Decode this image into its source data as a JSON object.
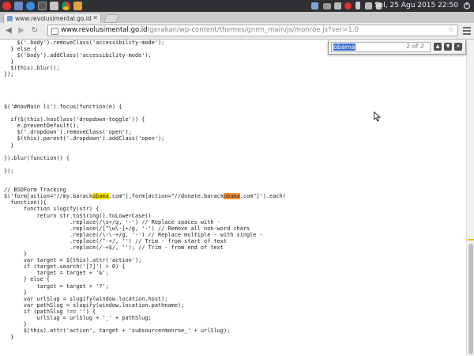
{
  "system_panel": {
    "clock": "Sel, 25 Agu 2015 22:50",
    "icons": [
      "app-menu-icon",
      "files-icon",
      "browser-icon",
      "terminal-icon",
      "editor-icon",
      "chrome-icon",
      "image-icon"
    ],
    "tray_icons": [
      "update-icon",
      "mail-icon",
      "network-icon",
      "record-icon",
      "bluetooth-icon",
      "battery-icon",
      "volume-icon"
    ]
  },
  "browser": {
    "tab_title": "www.revolusimental.go.id",
    "url_host": "www.revolusimental.go.id",
    "url_path": "/gerakan/wp-content/themes/gnrm_main/js/monroe.js?ver=1.0"
  },
  "find_bar": {
    "query": "obama",
    "count": "2 of 2"
  },
  "code": {
    "lines": [
      [
        {
          "t": "    $('.body').removeClass('accessibility-mode');"
        }
      ],
      [
        {
          "t": "  } else {"
        }
      ],
      [
        {
          "t": "    $('body').addClass('accessibility-mode');"
        }
      ],
      [
        {
          "t": "  }"
        }
      ],
      [
        {
          "t": "  $(this).blur();"
        }
      ],
      [
        {
          "t": "});"
        }
      ],
      [
        {
          "t": ""
        }
      ],
      [
        {
          "t": ""
        }
      ],
      [
        {
          "t": ""
        }
      ],
      [
        {
          "t": ""
        }
      ],
      [
        {
          "t": "$('#navMain li').focus(function(e) {"
        }
      ],
      [
        {
          "t": ""
        }
      ],
      [
        {
          "t": "  if($(this).hasClass('dropdown-toggle')) {"
        }
      ],
      [
        {
          "t": "    e.preventDefault();"
        }
      ],
      [
        {
          "t": "    $('.dropdown').removeClass('open');"
        }
      ],
      [
        {
          "t": "    $(this).parent('.dropdown').addClass('open');"
        }
      ],
      [
        {
          "t": "  }"
        }
      ],
      [
        {
          "t": ""
        }
      ],
      [
        {
          "t": "}).blur(function() {"
        }
      ],
      [
        {
          "t": ""
        }
      ],
      [
        {
          "t": "});"
        }
      ],
      [
        {
          "t": ""
        }
      ],
      [
        {
          "t": ""
        }
      ],
      [
        {
          "t": "// BSDForm Tracking"
        }
      ],
      [
        {
          "t": "$('form[action=\"//my.barack"
        },
        {
          "t": "obama",
          "h": "hl"
        },
        {
          "t": ".com\"],form[action=\"//donate.barack"
        },
        {
          "t": "obama",
          "h": "hl-active"
        },
        {
          "t": ".com\"]').each("
        }
      ],
      [
        {
          "t": "  function(){"
        }
      ],
      [
        {
          "t": "      function slugify(str) {"
        }
      ],
      [
        {
          "t": "          return str.toString().toLowerCase()"
        }
      ],
      [
        {
          "t": "                    .replace(/\\s+/g, '-') // Replace spaces with -"
        }
      ],
      [
        {
          "t": "                    .replace(/[^\\w\\-]+/g, '-') // Remove all non-word chars"
        }
      ],
      [
        {
          "t": "                    .replace(/\\-\\-+/g, '-') // Replace multiple - with single -"
        }
      ],
      [
        {
          "t": "                    .replace(/^-+/, '') // Trim - from start of text"
        }
      ],
      [
        {
          "t": "                    .replace(/-+$/, ''); // Trim - from end of text"
        }
      ],
      [
        {
          "t": "      }"
        }
      ],
      [
        {
          "t": "      var target = $(this).attr('action');"
        }
      ],
      [
        {
          "t": "      if (target.search('[?]') > 0) {"
        }
      ],
      [
        {
          "t": "          target = target + '&';"
        }
      ],
      [
        {
          "t": "      } else {"
        }
      ],
      [
        {
          "t": "          target = target + '?';"
        }
      ],
      [
        {
          "t": "      }"
        }
      ],
      [
        {
          "t": "      var urlSlug = slugify(window.location.host);"
        }
      ],
      [
        {
          "t": "      var pathSlug = slugify(window.location.pathname);"
        }
      ],
      [
        {
          "t": "      if (pathSlug !== '') {"
        }
      ],
      [
        {
          "t": "          urlSlug = urlSlug + '_' + pathSlug;"
        }
      ],
      [
        {
          "t": "      }"
        }
      ],
      [
        {
          "t": "      $(this).attr('action', target + 'subsource=monroe_' + urlSlug);"
        }
      ],
      [
        {
          "t": "  }"
        }
      ]
    ]
  }
}
